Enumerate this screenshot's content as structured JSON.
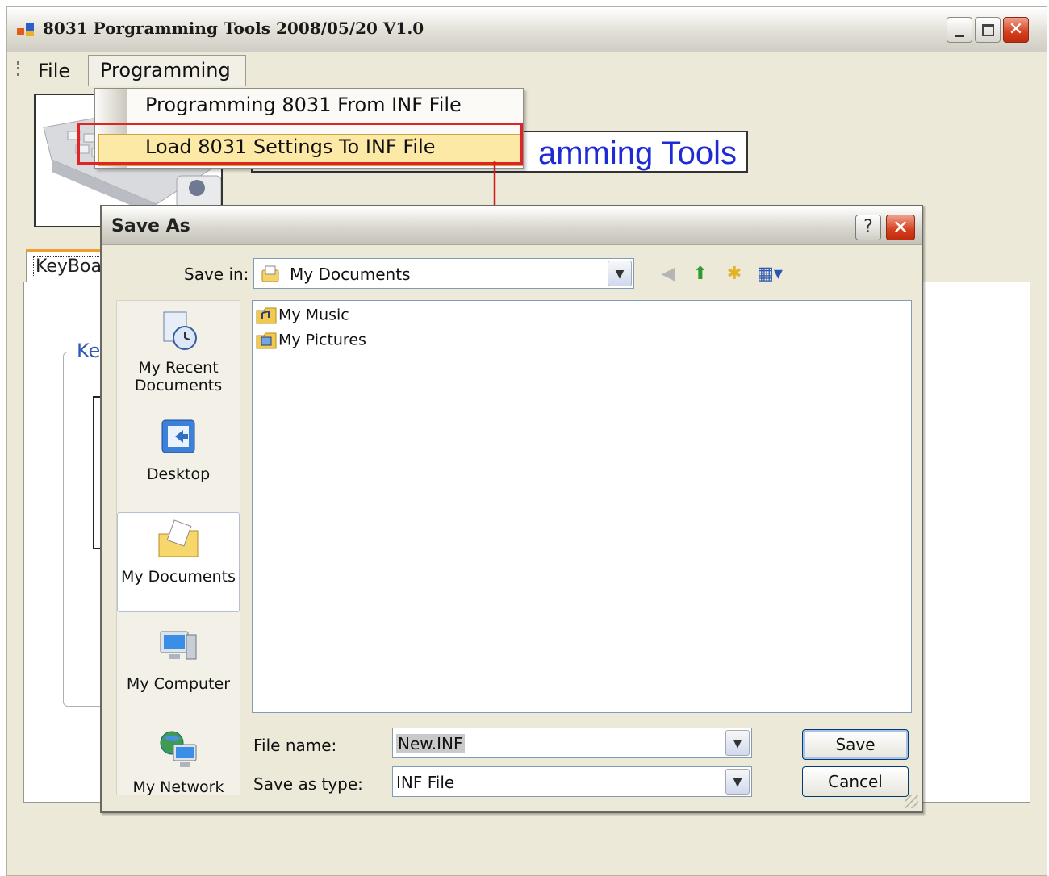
{
  "window": {
    "title": "8031 Porgramming Tools 2008/05/20 V1.0"
  },
  "menubar": {
    "items": [
      {
        "label": "File"
      },
      {
        "label": "Programming"
      }
    ]
  },
  "programming_menu": {
    "items": [
      {
        "label": "Programming 8031 From INF File"
      },
      {
        "label": "Load 8031 Settings To INF File"
      }
    ],
    "highlighted_index": 1
  },
  "main": {
    "header_title": "amming Tools",
    "tab_label": "KeyBoa",
    "group_label": "Ke"
  },
  "dialog": {
    "title": "Save As",
    "help_label": "?",
    "save_in_label": "Save in:",
    "save_in_value": "My Documents",
    "places": [
      {
        "label": "My Recent Documents",
        "icon": "recent-documents-icon"
      },
      {
        "label": "Desktop",
        "icon": "desktop-icon"
      },
      {
        "label": "My Documents",
        "icon": "my-documents-icon"
      },
      {
        "label": "My Computer",
        "icon": "my-computer-icon"
      },
      {
        "label": "My Network",
        "icon": "my-network-icon"
      }
    ],
    "files": [
      {
        "name": "My Music",
        "icon": "music-folder-icon"
      },
      {
        "name": "My Pictures",
        "icon": "pictures-folder-icon"
      }
    ],
    "file_name_label": "File name:",
    "file_name_value": "New.INF",
    "save_type_label": "Save as type:",
    "save_type_value": "INF File",
    "save_button": "Save",
    "cancel_button": "Cancel"
  },
  "colors": {
    "title_text_blue": "#1e2ad4",
    "highlight_box_red": "#e32224",
    "menu_highlight": "#fde9a6"
  }
}
